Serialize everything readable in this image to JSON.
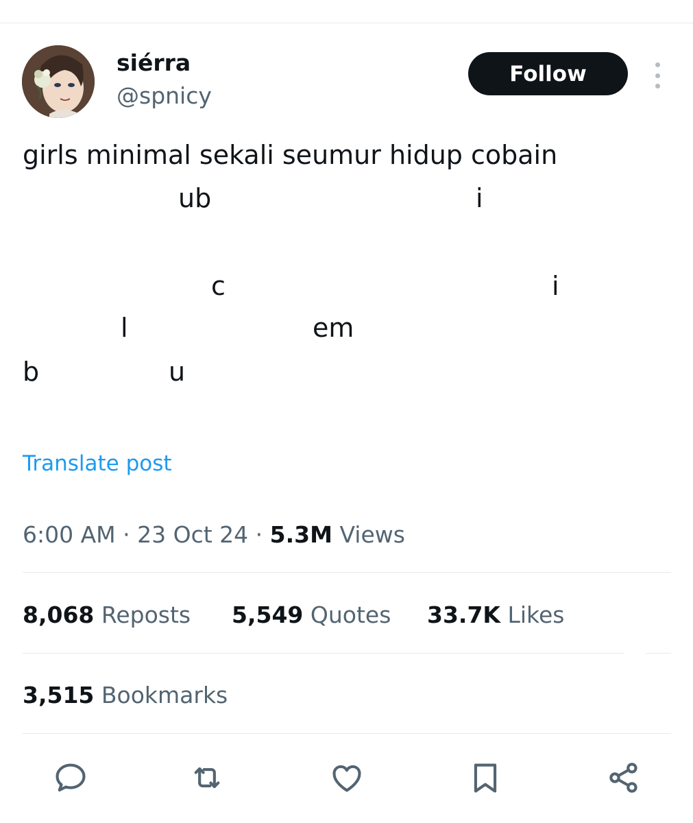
{
  "author": {
    "display_name": "siérra",
    "handle": "@spnicy"
  },
  "follow_label": "Follow",
  "post": {
    "line1": "girls minimal sekali seumur hidup cobain",
    "fragments": [
      "ub",
      "i",
      "c",
      "i",
      "l",
      "em",
      "b",
      "u"
    ]
  },
  "translate_label": "Translate post",
  "meta": {
    "time": "6:00 AM",
    "sep1": " · ",
    "date": "23 Oct 24",
    "sep2": " · ",
    "views_count": "5.3M",
    "views_label": " Views"
  },
  "stats": {
    "reposts": {
      "count": "8,068",
      "label": " Reposts"
    },
    "quotes": {
      "count": "5,549",
      "label": " Quotes"
    },
    "likes": {
      "count": "33.7K",
      "label": " Likes"
    },
    "bookmarks": {
      "count": "3,515",
      "label": " Bookmarks"
    }
  },
  "actions": [
    "reply-icon",
    "repost-icon",
    "like-icon",
    "bookmark-icon",
    "share-icon"
  ],
  "colors": {
    "text": "#0f1419",
    "secondary": "#536471",
    "link": "#1d9bf0",
    "follow_bg": "#0f1419",
    "divider": "#e7e9ea"
  }
}
